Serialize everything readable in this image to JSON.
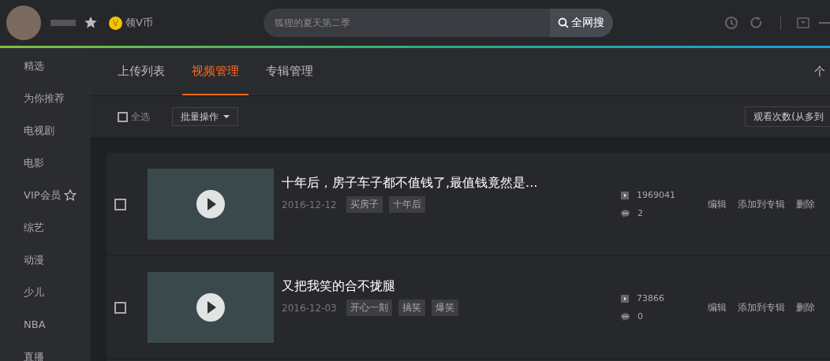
{
  "top_bar": {
    "coin_letter": "V",
    "vip_link": "领V币",
    "search": {
      "placeholder": "狐狸的夏天第二季",
      "button": "全网搜"
    }
  },
  "sidebar": {
    "items": [
      {
        "label": "精选",
        "vip": false
      },
      {
        "label": "为你推荐",
        "vip": false
      },
      {
        "label": "电视剧",
        "vip": false
      },
      {
        "label": "电影",
        "vip": false
      },
      {
        "label": "VIP会员",
        "vip": true
      },
      {
        "label": "综艺",
        "vip": false
      },
      {
        "label": "动漫",
        "vip": false
      },
      {
        "label": "少儿",
        "vip": false
      },
      {
        "label": "NBA",
        "vip": false
      },
      {
        "label": "直播",
        "vip": false
      }
    ]
  },
  "tabs": [
    {
      "label": "上传列表",
      "selected": false
    },
    {
      "label": "视频管理",
      "selected": true
    },
    {
      "label": "专辑管理",
      "selected": false
    }
  ],
  "right_link": "个",
  "toolbar": {
    "select_all": {
      "label": "全选",
      "checked": false
    },
    "batch_button": "批量操作",
    "sort": "观看次数(从多到"
  },
  "videos": [
    {
      "checked": false,
      "title": "十年后，房子车子都不值钱了,最值钱竟然是...",
      "date": "2016-12-12",
      "tags": [
        "买房子",
        "十年后"
      ],
      "plays": "1969041",
      "comments": "2",
      "actions": [
        "编辑",
        "添加到专辑",
        "删除"
      ]
    },
    {
      "checked": false,
      "title": "又把我笑的合不拢腿",
      "date": "2016-12-03",
      "tags": [
        "开心一刻",
        "搞笑",
        "爆笑"
      ],
      "plays": "73866",
      "comments": "0",
      "actions": [
        "编辑",
        "添加到专辑",
        "删除"
      ]
    }
  ]
}
